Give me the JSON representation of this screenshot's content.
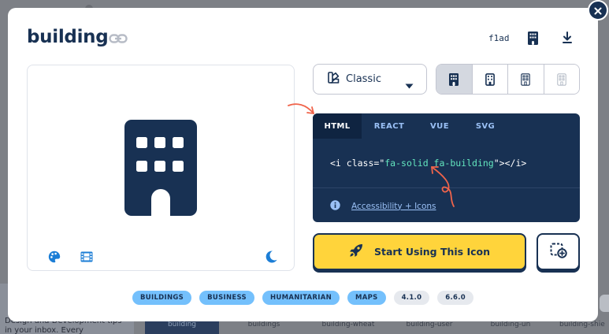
{
  "modal": {
    "title": "building",
    "unicode": "f1ad"
  },
  "style_select": {
    "value": "Classic"
  },
  "code": {
    "tabs": [
      "HTML",
      "REACT",
      "VUE",
      "SVG"
    ],
    "active_tab": "HTML",
    "open": "<i class=",
    "quote_open": "\"",
    "class_value": "fa-solid fa-building",
    "quote_close": "\"",
    "close": "></i>",
    "accessibility_link": "Accessibility + Icons"
  },
  "cta": {
    "label": "Start Using This Icon"
  },
  "tags": {
    "categories": [
      "BUILDINGS",
      "BUSINESS",
      "HUMANITARIAN",
      "MAPS"
    ],
    "versions": [
      "4.1.0",
      "6.6.0"
    ]
  },
  "background": {
    "promo_text": "Design and Development tips in your inbox. Every",
    "tiles": [
      "building",
      "buildings",
      "building-wheat",
      "building-user",
      "building-un",
      "building-shie"
    ]
  },
  "colors": {
    "navy": "#183153",
    "accent_yellow": "#ffd43b",
    "tag_blue": "#74c0fc",
    "code_green": "#63e6be",
    "link_blue": "#9ac0f5",
    "doodle_orange": "#f0644b"
  },
  "icons": {
    "close": "close-icon",
    "link": "link-icon",
    "building": "building-icon",
    "download": "download-icon",
    "palette": "palette-icon",
    "film": "film-icon",
    "moon": "moon-icon",
    "style": "shapes-icon",
    "caret": "caret-down-icon",
    "info": "info-circle-icon",
    "rocket": "rocket-icon",
    "add": "add-to-collection-icon"
  }
}
